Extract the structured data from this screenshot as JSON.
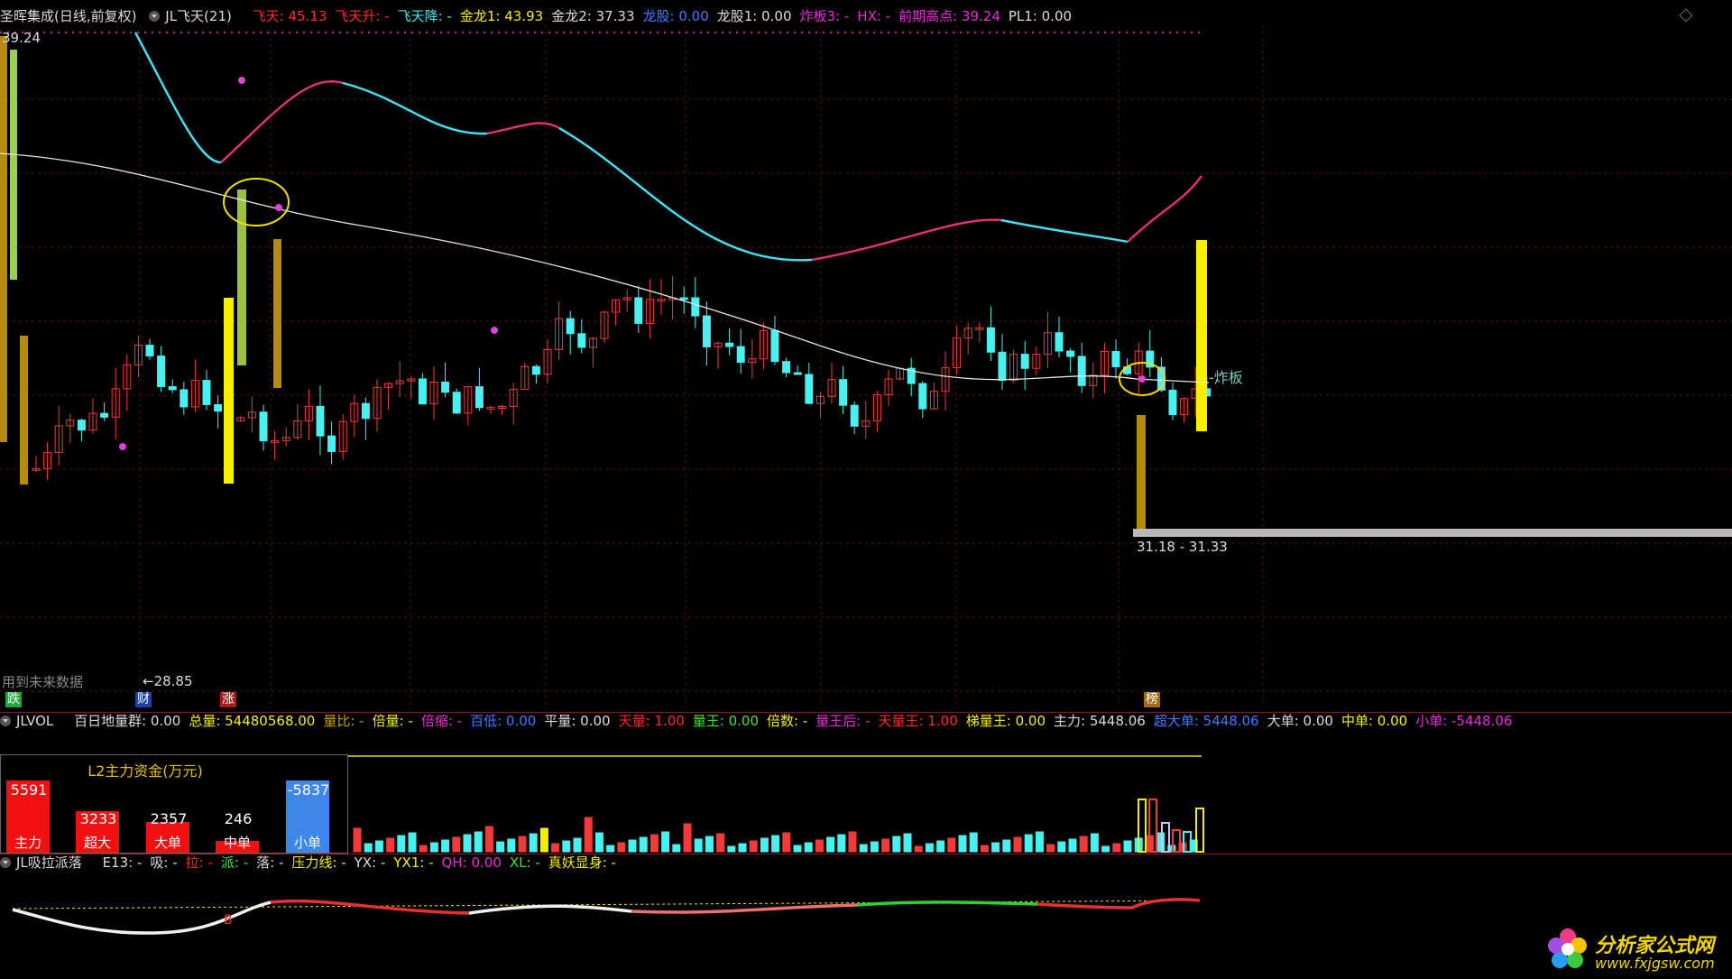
{
  "top_bar": {
    "title": "圣晖集成(日线,前复权)",
    "indicator": "JL飞天(21)",
    "items": [
      {
        "label": "飞天: 45.13",
        "color": "r"
      },
      {
        "label": "飞天升: -",
        "color": "r"
      },
      {
        "label": "飞天降: -",
        "color": "c"
      },
      {
        "label": "金龙1: 43.93",
        "color": "y"
      },
      {
        "label": "金龙2: 37.33",
        "color": "w"
      },
      {
        "label": "龙股: 0.00",
        "color": "b"
      },
      {
        "label": "龙股1: 0.00",
        "color": "w"
      },
      {
        "label": "炸板3: -",
        "color": "m"
      },
      {
        "label": "HX: -",
        "color": "m"
      },
      {
        "label": "前期高点: 39.24",
        "color": "m"
      },
      {
        "label": "PL1: 0.00",
        "color": "w"
      }
    ]
  },
  "main_chart": {
    "price_high": "39.24",
    "price_low": "←28.85",
    "zhaban_label": "-炸板",
    "range_label": "31.18 - 31.33",
    "future_data_note": "用到未来数据",
    "markers": [
      {
        "text": "跌",
        "bg": "#1faa3a"
      },
      {
        "text": "财",
        "bg": "#1b3fae"
      },
      {
        "text": "涨",
        "bg": "#b01818"
      },
      {
        "text": "榜",
        "bg": "#a06a10"
      }
    ]
  },
  "vol_bar": {
    "name": "JLVOL",
    "items": [
      {
        "label": "百日地量群: 0.00",
        "color": "w"
      },
      {
        "label": "总量: 54480568.00",
        "color": "y"
      },
      {
        "label": "量比: -",
        "color": "o"
      },
      {
        "label": "倍量: -",
        "color": "y"
      },
      {
        "label": "倍缩: -",
        "color": "m"
      },
      {
        "label": "百低: 0.00",
        "color": "b"
      },
      {
        "label": "平量: 0.00",
        "color": "w"
      },
      {
        "label": "天量: 1.00",
        "color": "r"
      },
      {
        "label": "量王: 0.00",
        "color": "g"
      },
      {
        "label": "倍数: -",
        "color": "y"
      },
      {
        "label": "量王后: -",
        "color": "m"
      },
      {
        "label": "天量王: 1.00",
        "color": "r"
      },
      {
        "label": "梯量王: 0.00",
        "color": "y"
      },
      {
        "label": "主力: 5448.06",
        "color": "w"
      },
      {
        "label": "超大单: 5448.06",
        "color": "b"
      },
      {
        "label": "大单: 0.00",
        "color": "w"
      },
      {
        "label": "中单: 0.00",
        "color": "y"
      },
      {
        "label": "小单: -5448.06",
        "color": "m"
      }
    ]
  },
  "l2_panel": {
    "title": "L2主力资金(万元)",
    "columns": [
      {
        "value": "5591",
        "label": "主力",
        "fill": 1.0,
        "color": "#f21010"
      },
      {
        "value": "3233",
        "label": "超大",
        "fill": 0.58,
        "color": "#f21010"
      },
      {
        "value": "2357",
        "label": "大单",
        "fill": 0.42,
        "color": "#f21010"
      },
      {
        "value": "246",
        "label": "中单",
        "fill": 0.16,
        "color": "#f21010"
      },
      {
        "value": "-5837",
        "label": "小单",
        "fill": 1.0,
        "color": "#3e86e8"
      }
    ]
  },
  "bottom_bar": {
    "name": "JL吸拉派落",
    "items": [
      {
        "label": "E13: -",
        "color": "w"
      },
      {
        "label": "吸: -",
        "color": "w"
      },
      {
        "label": "拉: -",
        "color": "r"
      },
      {
        "label": "派: -",
        "color": "g"
      },
      {
        "label": "落: -",
        "color": "w"
      },
      {
        "label": "压力线: -",
        "color": "y"
      },
      {
        "label": "YX: -",
        "color": "w"
      },
      {
        "label": "YX1: -",
        "color": "y"
      },
      {
        "label": "QH: 0.00",
        "color": "m"
      },
      {
        "label": "XL: -",
        "color": "g"
      },
      {
        "label": "真妖显身: -",
        "color": "y"
      }
    ],
    "marker_b": "B"
  },
  "logo": {
    "title": "分析家公式网",
    "url": "www.fxjgsw.com"
  }
}
